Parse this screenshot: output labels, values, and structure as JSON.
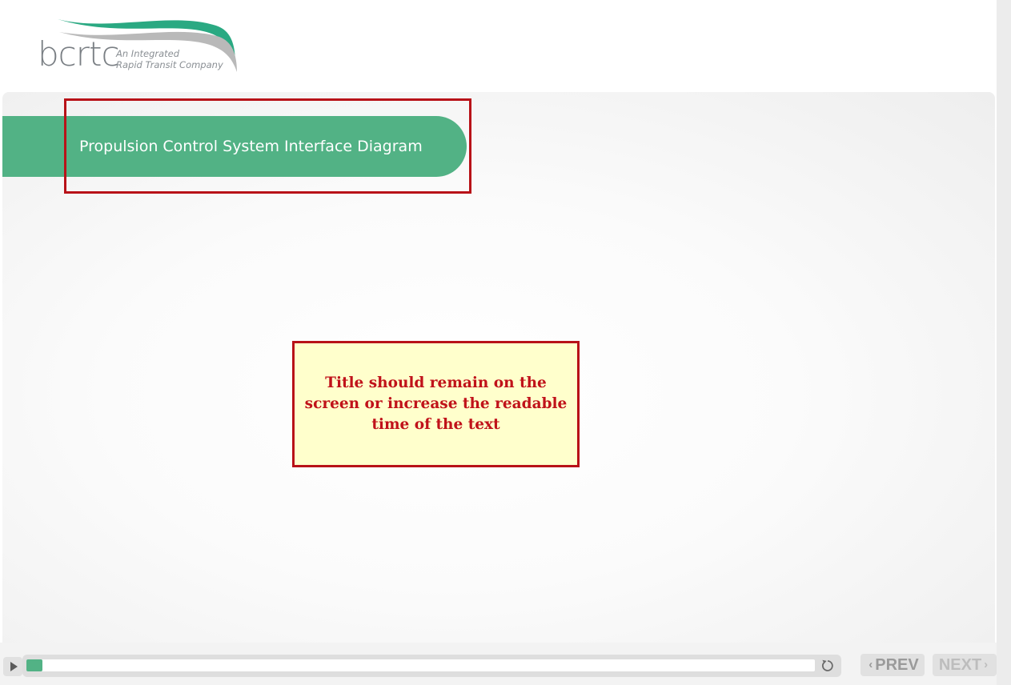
{
  "header": {
    "logo": {
      "wordmark": "bcrtc",
      "tagline_line1": "An Integrated",
      "tagline_line2": "Rapid Transit Company"
    }
  },
  "slide": {
    "title": "Propulsion Control System Interface Diagram",
    "review_note": "Title should remain on the screen or increase the readable time of the text"
  },
  "player": {
    "progress_percent": 2,
    "prev_label": "PREV",
    "next_label": "NEXT",
    "prev_chevron": "‹",
    "next_chevron": "›"
  },
  "colors": {
    "brand_green": "#52b285",
    "highlight_red": "#b81218",
    "note_background": "#ffffcc",
    "logo_gray": "#7a7f84"
  },
  "icons": {
    "play": "play-icon",
    "replay": "replay-icon",
    "prev": "chevron-left-icon",
    "next": "chevron-right-icon"
  }
}
